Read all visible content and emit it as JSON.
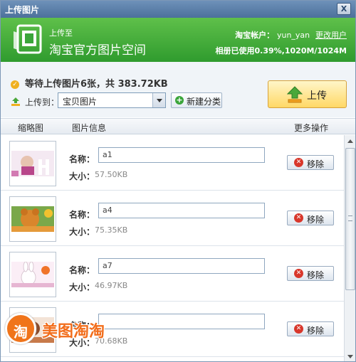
{
  "window": {
    "title": "上传图片",
    "close_symbol": "X"
  },
  "header": {
    "upload_to_label": "上传至",
    "service_name": "淘宝官方图片空间",
    "account_label": "淘宝帐户：",
    "account_user": "yun_yan",
    "change_user_link": "更改用户",
    "quota_text": "相册已使用0.39%,1020M/1024M"
  },
  "panel": {
    "waiting_text": "等待上传图片6张，共 383.72KB",
    "upload_to": "上传到：",
    "album_selected": "宝贝图片",
    "new_category": "新建分类",
    "upload_button": "上传"
  },
  "columns": {
    "thumbnail": "缩略图",
    "info": "图片信息",
    "more": "更多操作"
  },
  "labels": {
    "name": "名称：",
    "size": "大小：",
    "remove": "移除"
  },
  "items": [
    {
      "name": "a1",
      "size": "57.50KB"
    },
    {
      "name": "a4",
      "size": "75.35KB"
    },
    {
      "name": "a7",
      "size": "46.97KB"
    },
    {
      "name": "",
      "size": "70.68KB"
    }
  ],
  "watermark": {
    "badge": "淘",
    "text": "美图淘淘"
  },
  "colors": {
    "header_green": "#2f9b2e",
    "accent_orange": "#f26d1b",
    "upload_button": "#ffd866"
  }
}
